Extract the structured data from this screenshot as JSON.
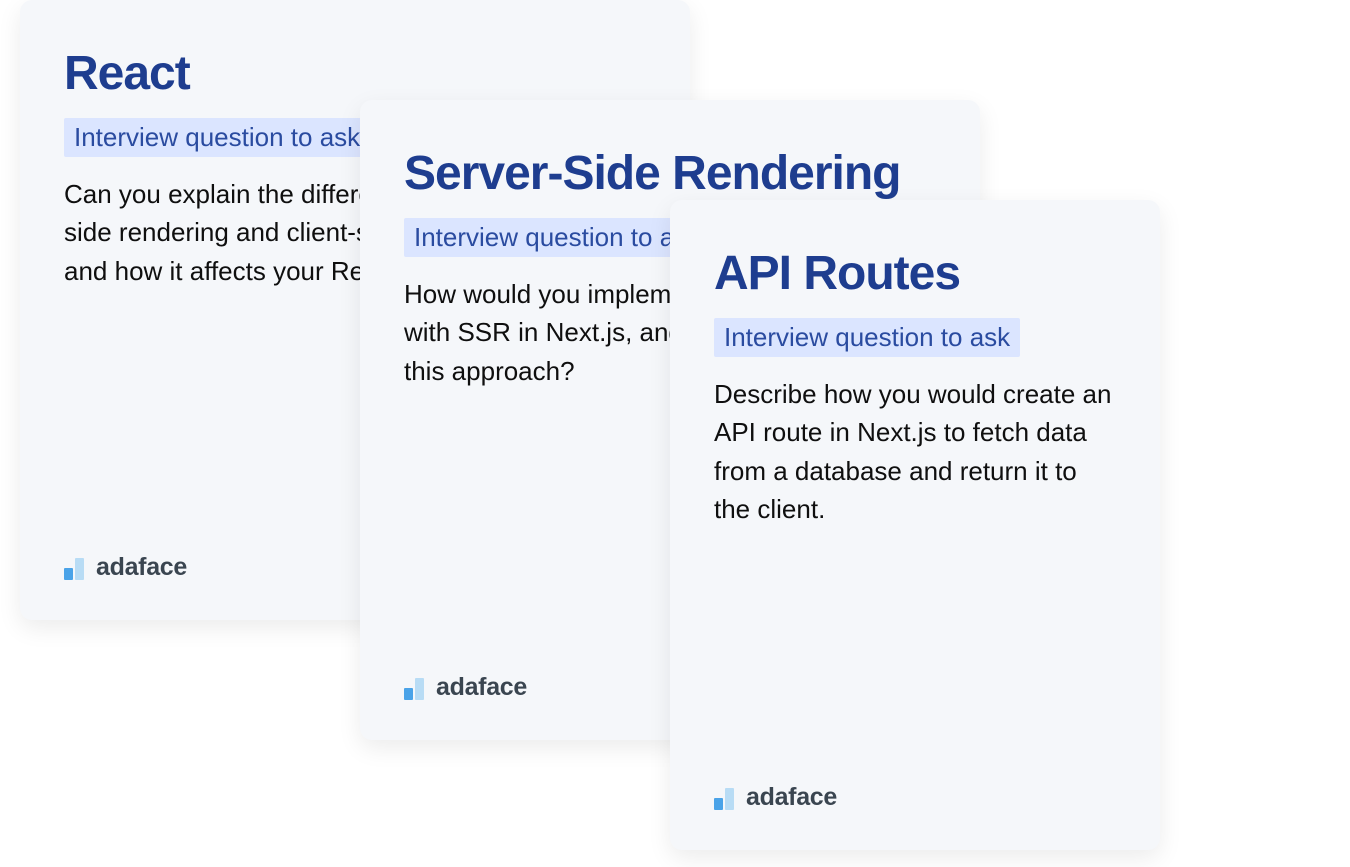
{
  "cards": [
    {
      "title": "React",
      "subtitle": "Interview question to ask",
      "body": "Can you explain the difference between server-side rendering and client-side rendering in Next.js, and how it affects your React components?",
      "brand": "adaface"
    },
    {
      "title": "Server-Side Rendering",
      "subtitle": "Interview question to ask",
      "body": "How would you implement dynamic routes with SSR in Next.js, and what is the benefit of this approach?",
      "brand": "adaface"
    },
    {
      "title": "API Routes",
      "subtitle": "Interview question to ask",
      "body": "Describe how you would create an API route in Next.js to fetch data from a database and return it to the client.",
      "brand": "adaface"
    }
  ]
}
